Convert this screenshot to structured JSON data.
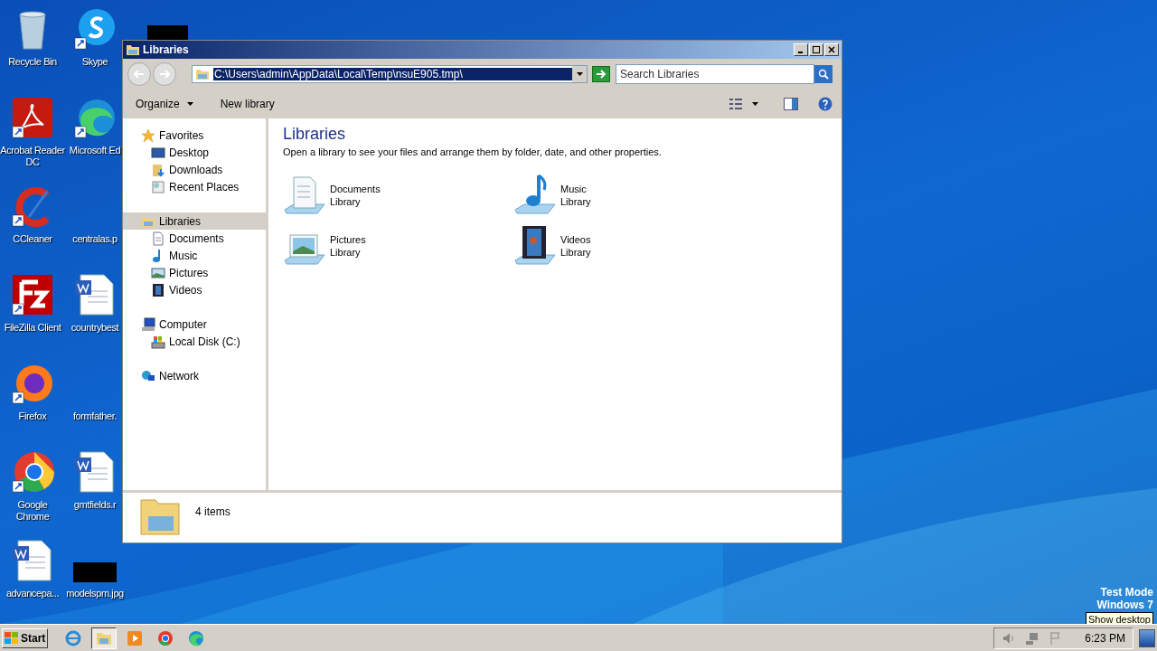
{
  "desktop_icons": [
    {
      "label": "Recycle Bin",
      "kind": "recycle"
    },
    {
      "label": "Acrobat Reader DC",
      "kind": "acrobat"
    },
    {
      "label": "CCleaner",
      "kind": "ccleaner"
    },
    {
      "label": "FileZilla Client",
      "kind": "filezilla"
    },
    {
      "label": "Firefox",
      "kind": "firefox"
    },
    {
      "label": "Google Chrome",
      "kind": "chrome"
    },
    {
      "label": "advancepa...",
      "kind": "word"
    },
    {
      "label": "Skype",
      "kind": "skype"
    },
    {
      "label": "Microsoft Ed",
      "kind": "edge"
    },
    {
      "label": "centralas.p",
      "kind": "blank"
    },
    {
      "label": "countrybest",
      "kind": "word"
    },
    {
      "label": "formfather.",
      "kind": "blank"
    },
    {
      "label": "gmtfields.r",
      "kind": "word"
    },
    {
      "label": "modelspm.jpg",
      "kind": "redacted"
    }
  ],
  "window": {
    "title": "Libraries",
    "address": "C:\\Users\\admin\\AppData\\Local\\Temp\\nsuE905.tmp\\",
    "search": {
      "placeholder": "Search Libraries"
    },
    "toolbar": [
      {
        "label": "Organize",
        "kind": "dropdown"
      },
      {
        "label": "New library",
        "kind": "plain"
      }
    ],
    "nav": [
      {
        "label": "Favorites",
        "kind": "star",
        "selected": false,
        "children": [
          {
            "label": "Desktop",
            "kind": "desktop",
            "selected": false
          },
          {
            "label": "Downloads",
            "kind": "downloads",
            "selected": false
          },
          {
            "label": "Recent Places",
            "kind": "recent",
            "selected": false
          }
        ]
      },
      {
        "label": "Libraries",
        "kind": "libraries",
        "selected": true,
        "children": [
          {
            "label": "Documents",
            "kind": "documents",
            "selected": false
          },
          {
            "label": "Music",
            "kind": "music",
            "selected": false
          },
          {
            "label": "Pictures",
            "kind": "pictures",
            "selected": false
          },
          {
            "label": "Videos",
            "kind": "videos",
            "selected": false
          }
        ]
      },
      {
        "label": "Computer",
        "kind": "computer",
        "selected": false,
        "children": [
          {
            "label": "Local Disk (C:)",
            "kind": "disk",
            "selected": false
          }
        ]
      },
      {
        "label": "Network",
        "kind": "network",
        "selected": false
      }
    ],
    "heading": "Libraries",
    "description": "Open a library to see your files and arrange them by folder, date, and other properties.",
    "libraries": [
      {
        "name": "Documents",
        "subtitle": "Library",
        "kind": "documents"
      },
      {
        "name": "Music",
        "subtitle": "Library",
        "kind": "music"
      },
      {
        "name": "Pictures",
        "subtitle": "Library",
        "kind": "pictures"
      },
      {
        "name": "Videos",
        "subtitle": "Library",
        "kind": "videos"
      }
    ],
    "status": "4 items"
  },
  "watermark_text": [
    "Test Mode",
    "Windows 7"
  ],
  "tooltip": "Show desktop",
  "taskbar": {
    "start": "Start",
    "apps": [
      {
        "kind": "ie",
        "selected": false
      },
      {
        "kind": "explorer",
        "selected": true
      },
      {
        "kind": "media",
        "selected": false
      },
      {
        "kind": "chrome",
        "selected": false
      },
      {
        "kind": "edge",
        "selected": false
      }
    ],
    "clock": "6:23 PM"
  }
}
